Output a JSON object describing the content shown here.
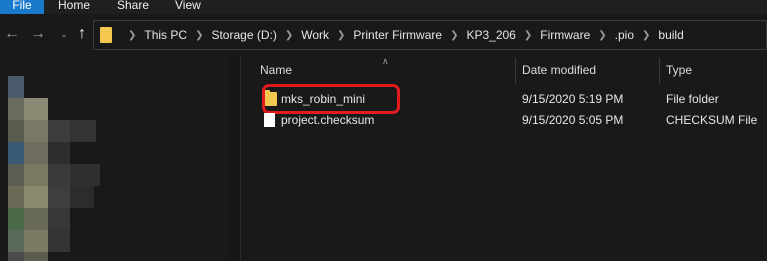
{
  "ribbon": {
    "tabs": [
      "File",
      "Home",
      "Share",
      "View"
    ]
  },
  "nav": {
    "back_icon": "←",
    "forward_icon": "→",
    "recent_icon": "⌄",
    "up_icon": "↑"
  },
  "address": {
    "breadcrumbs": [
      "This PC",
      "Storage (D:)",
      "Work",
      "Printer Firmware",
      "KP3_206",
      "Firmware",
      ".pio",
      "build"
    ]
  },
  "columns": {
    "name": "Name",
    "date": "Date modified",
    "type": "Type"
  },
  "files": [
    {
      "name": "mks_robin_mini",
      "date": "9/15/2020 5:19 PM",
      "type": "File folder",
      "icon": "folder-icon",
      "highlighted": true
    },
    {
      "name": "project.checksum",
      "date": "9/15/2020 5:05 PM",
      "type": "CHECKSUM File",
      "icon": "file-icon",
      "highlighted": false
    }
  ],
  "colors": {
    "accent": "#1979ca",
    "highlight": "#e21c1c",
    "folder": "#f4c84f"
  }
}
